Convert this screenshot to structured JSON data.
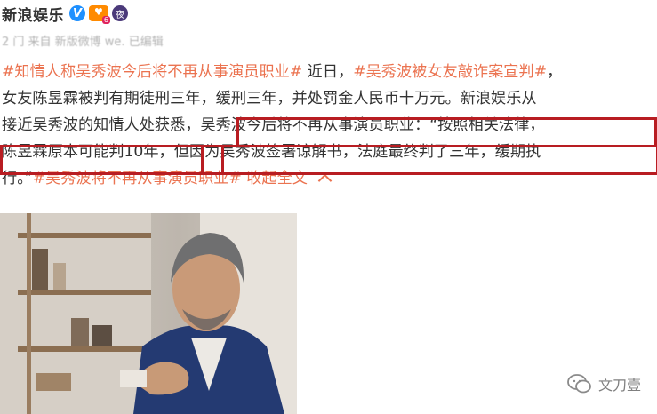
{
  "header": {
    "username": "新浪娱乐",
    "verified_icon": "verified-v-icon",
    "vip_icon": "heart-vip-icon",
    "night_icon": "night-mode-icon",
    "colors": {
      "verified": "#1e90ff",
      "vip": "#ff8a00",
      "night": "#4b3a7a"
    }
  },
  "meta_text": "2   门         来自 新版微博 we.              已编辑",
  "post": {
    "line1": {
      "tag1": "#知情人称吴秀波今后将不再从事演员职业#",
      "text1": " 近日，",
      "tag2": "#吴秀波被女友敲诈案宣判#",
      "text2": "，"
    },
    "line2": "女友陈昱霖被判有期徒刑三年，缓刑三年，并处罚金人民币十万元。新浪娱乐从",
    "line3": {
      "pre": "接近吴秀波的知情人处获悉，",
      "quote": "吴秀波今后将不再从事演员职业：“按照相关法律，"
    },
    "line4": {
      "q1": "陈昱霖原本可能判10年，",
      "q2": "但因为吴秀波签署谅解书，法庭最终判了三年，缓期执"
    },
    "line5": {
      "end": "行。”",
      "tag3": "#吴秀波将不再从事演员职业#",
      "collapse": "收起全文"
    },
    "colors": {
      "tag": "#eb7350",
      "highlight_border": "#b81d22",
      "text": "#333333"
    }
  },
  "image": {
    "description_icon": "portrait-photo"
  },
  "watermark": {
    "label": "文刀壹",
    "icon": "wechat-icon"
  }
}
